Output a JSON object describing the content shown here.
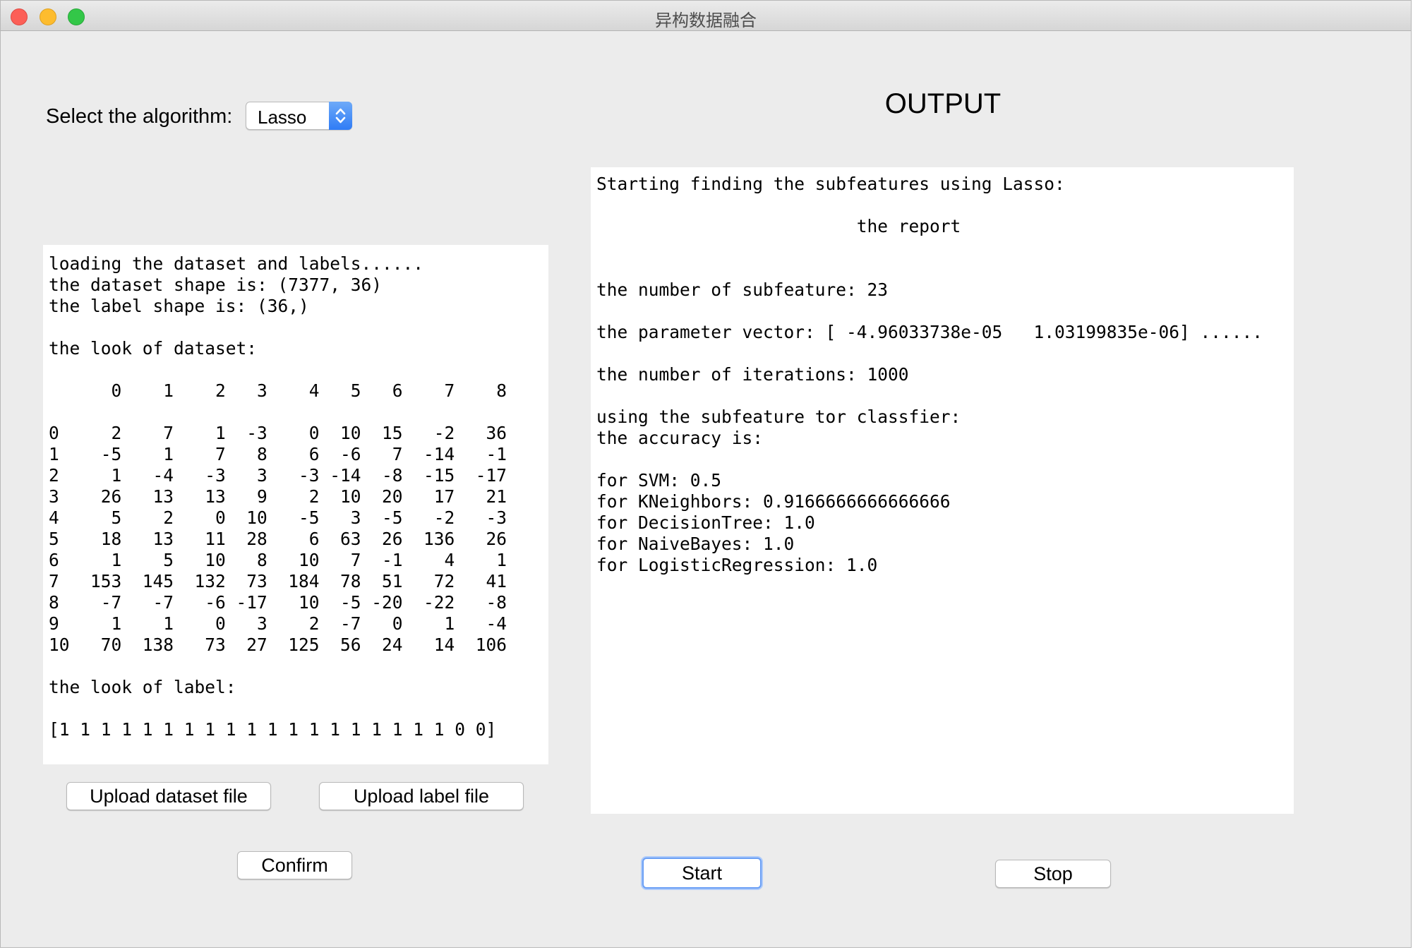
{
  "window": {
    "title": "异构数据融合"
  },
  "algorithm": {
    "label": "Select the algorithm:",
    "selected": "Lasso"
  },
  "output": {
    "title": "OUTPUT"
  },
  "dataset_log": {
    "text": "loading the dataset and labels......\nthe dataset shape is: (7377, 36)\nthe label shape is: (36,)\n\nthe look of dataset:\n\n      0    1    2   3    4   5   6    7    8\n\n0     2    7    1  -3    0  10  15   -2   36\n1    -5    1    7   8    6  -6   7  -14   -1\n2     1   -4   -3   3   -3 -14  -8  -15  -17\n3    26   13   13   9    2  10  20   17   21\n4     5    2    0  10   -5   3  -5   -2   -3\n5    18   13   11  28    6  63  26  136   26\n6     1    5   10   8   10   7  -1    4    1\n7   153  145  132  73  184  78  51   72   41\n8    -7   -7   -6 -17   10  -5 -20  -22   -8\n9     1    1    0   3    2  -7   0    1   -4\n10   70  138   73  27  125  56  24   14  106\n\nthe look of label:\n\n[1 1 1 1 1 1 1 1 1 1 1 1 1 1 1 1 1 1 1 0 0]"
  },
  "report_log": {
    "text": "Starting finding the subfeatures using Lasso:\n\n                         the report\n\n\nthe number of subfeature: 23\n\nthe parameter vector: [ -4.96033738e-05   1.03199835e-06] ......\n\nthe number of iterations: 1000\n\nusing the subfeature tor classfier:\nthe accuracy is:\n\nfor SVM: 0.5\nfor KNeighbors: 0.9166666666666666\nfor DecisionTree: 1.0\nfor NaiveBayes: 1.0\nfor LogisticRegression: 1.0"
  },
  "buttons": {
    "upload_dataset": "Upload dataset file",
    "upload_label": "Upload label file",
    "confirm": "Confirm",
    "start": "Start",
    "stop": "Stop"
  },
  "colors": {
    "window_bg": "#ececec",
    "accent": "#2f7cf6",
    "close": "#fc5f57",
    "minimize": "#fdbc2e",
    "maximize": "#33c748"
  }
}
